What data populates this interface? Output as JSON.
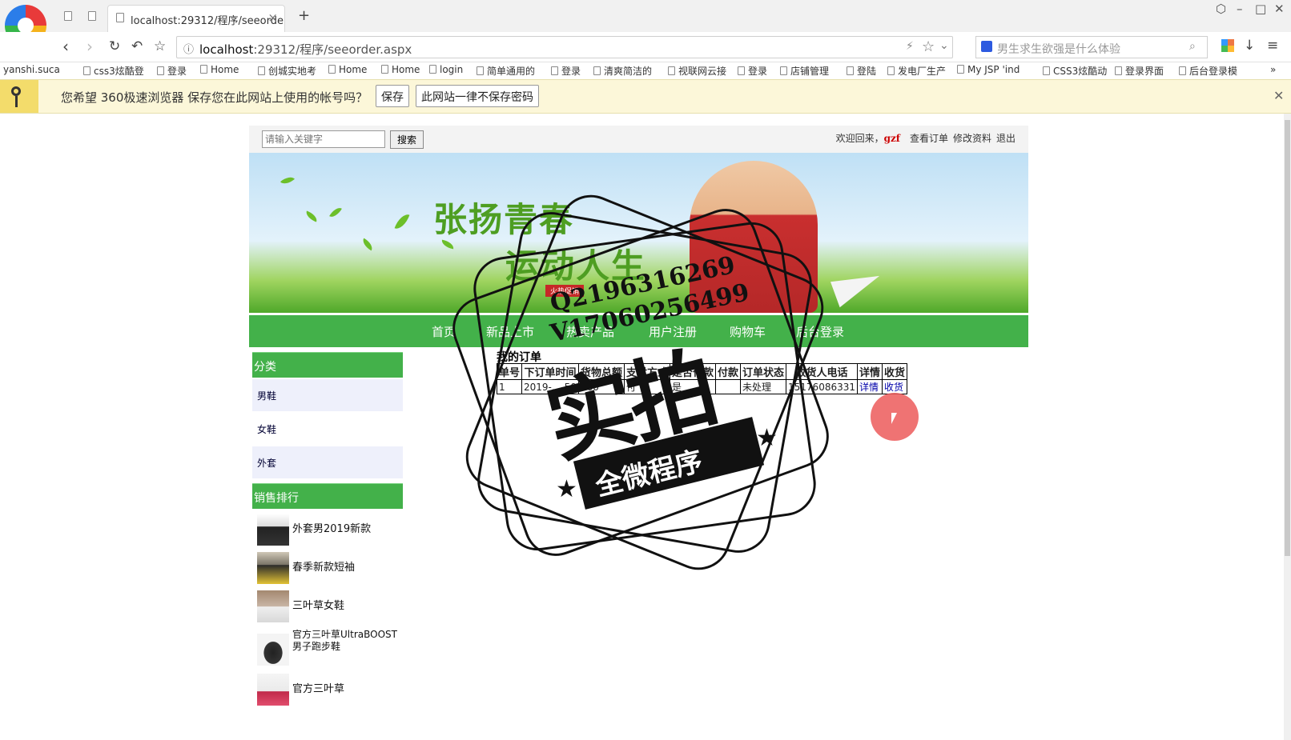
{
  "browser": {
    "tabs": [
      {
        "label": "localhost:29312/程序/seeorde",
        "active": true
      }
    ],
    "address": "localhost:29312/程序/seeorder.aspx",
    "address_host": "localhost",
    "address_rest": ":29312/程序/seeorder.aspx",
    "search_placeholder": "男生求生欲强是什么体验",
    "bookmarks": [
      "yanshi.suca",
      "css3炫酷登",
      "登录",
      "Home",
      "创城实地考",
      "Home",
      "Home",
      "login",
      "简单通用的",
      "登录",
      "清爽简洁的",
      "视联网云接",
      "登录",
      "店铺管理",
      "登陆",
      "发电厂生产",
      "My JSP 'ind",
      "CSS3炫酷动",
      "登录界面",
      "后台登录模"
    ],
    "bookmarks_more": "»",
    "password_prompt": {
      "message": "您希望 360极速浏览器 保存您在此网站上使用的帐号吗？",
      "save_label": "保存",
      "never_label": "此网站一律不保存密码"
    }
  },
  "site": {
    "search_placeholder": "请输入关键字",
    "search_button": "搜索",
    "welcome": "欢迎回来，",
    "username": "gzf",
    "links": [
      "查看订单",
      "修改资料",
      "退出"
    ],
    "banner_title_1": "张扬青春",
    "banner_title_2": "运动人生",
    "banner_tag": "火热促销",
    "menu": [
      "首页",
      "新品上市",
      "热卖产品",
      "用户注册",
      "购物车",
      "后台登录"
    ],
    "sidebar": {
      "category_title": "分类",
      "categories": [
        "男鞋",
        "女鞋",
        "外套"
      ],
      "ranking_title": "销售排行",
      "ranking": [
        "外套男2019新款",
        "春季新款短袖",
        "三叶草女鞋",
        "官方三叶草UltraBOOST男子跑步鞋",
        "官方三叶草"
      ]
    },
    "orders": {
      "title": "我的订单",
      "columns": [
        "单号",
        "下订单时间",
        "货物总额",
        "支付方式",
        "是否付款",
        "付款",
        "订单状态",
        "收货人电话",
        "详情",
        "收货"
      ],
      "rows": [
        [
          "1",
          "2019-...-50",
          "260",
          "付",
          "是",
          "",
          "未处理",
          "15176086331",
          "详情",
          "收货"
        ]
      ]
    }
  },
  "watermark": {
    "qq": "Q2196316269",
    "vx": "V17060256499",
    "big": "实拍",
    "ribbon": "全微程序"
  }
}
